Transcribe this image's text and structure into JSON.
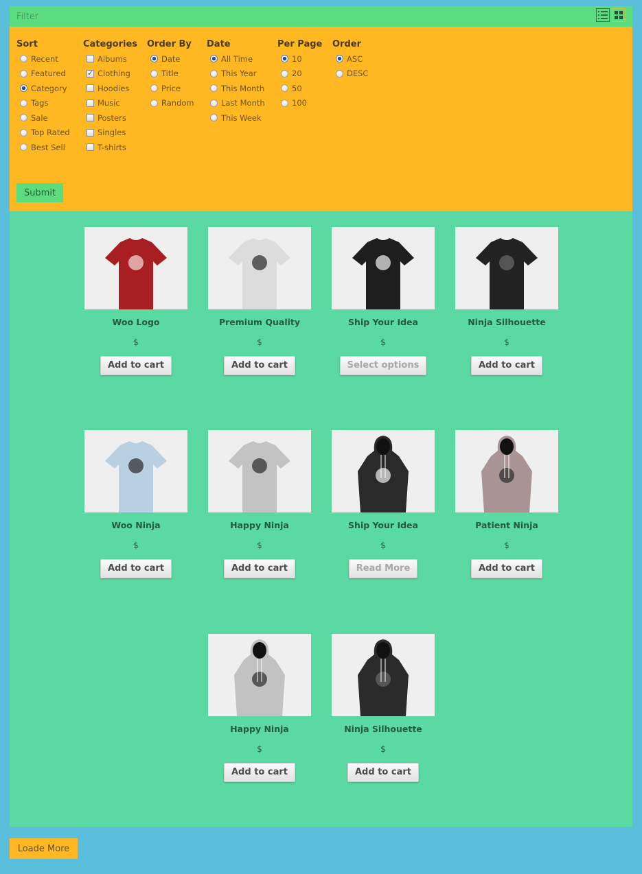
{
  "header": {
    "title": "Filter",
    "view_icons": [
      "list-view-icon",
      "grid-view-icon"
    ]
  },
  "filters": {
    "sort": {
      "heading": "Sort",
      "type": "radio",
      "options": [
        "Recent",
        "Featured",
        "Category",
        "Tags",
        "Sale",
        "Top Rated",
        "Best Sell"
      ],
      "selected": "Category"
    },
    "categories": {
      "heading": "Categories",
      "type": "checkbox",
      "options": [
        "Albums",
        "Clothing",
        "Hoodies",
        "Music",
        "Posters",
        "Singles",
        "T-shirts"
      ],
      "checked": [
        "Clothing"
      ]
    },
    "order_by": {
      "heading": "Order By",
      "type": "radio",
      "options": [
        "Date",
        "Title",
        "Price",
        "Random"
      ],
      "selected": "Date"
    },
    "date": {
      "heading": "Date",
      "type": "radio",
      "options": [
        "All Time",
        "This Year",
        "This Month",
        "Last Month",
        "This Week"
      ],
      "selected": "All Time"
    },
    "per_page": {
      "heading": "Per Page",
      "type": "radio",
      "options": [
        "10",
        "20",
        "50",
        "100"
      ],
      "selected": "10"
    },
    "order": {
      "heading": "Order",
      "type": "radio",
      "options": [
        "ASC",
        "DESC"
      ],
      "selected": "ASC"
    },
    "submit_label": "Submit"
  },
  "products": [
    {
      "name": "Woo Logo",
      "price": "$",
      "button": "Add to cart",
      "button_muted": false,
      "image": "red-tshirt-woo"
    },
    {
      "name": "Premium Quality",
      "price": "$",
      "button": "Add to cart",
      "button_muted": false,
      "image": "white-tshirt"
    },
    {
      "name": "Ship Your Idea",
      "price": "$",
      "button": "Select options",
      "button_muted": true,
      "image": "black-tshirt-skull"
    },
    {
      "name": "Ninja Silhouette",
      "price": "$",
      "button": "Add to cart",
      "button_muted": false,
      "image": "black-tshirt-ninja"
    },
    {
      "name": "Woo Ninja",
      "price": "$",
      "button": "Add to cart",
      "button_muted": false,
      "image": "blue-tshirt-ninja"
    },
    {
      "name": "Happy Ninja",
      "price": "$",
      "button": "Add to cart",
      "button_muted": false,
      "image": "grey-tshirt-ninja"
    },
    {
      "name": "Ship Your Idea",
      "price": "$",
      "button": "Read More",
      "button_muted": true,
      "image": "black-hoodie-skull"
    },
    {
      "name": "Patient Ninja",
      "price": "$",
      "button": "Add to cart",
      "button_muted": false,
      "image": "mauve-hoodie-ninja"
    },
    {
      "name": "Happy Ninja",
      "price": "$",
      "button": "Add to cart",
      "button_muted": false,
      "image": "grey-hoodie-ninja"
    },
    {
      "name": "Ninja Silhouette",
      "price": "$",
      "button": "Add to cart",
      "button_muted": false,
      "image": "black-hoodie-ninja"
    }
  ],
  "footer": {
    "load_more_label": "Loade More"
  },
  "colors": {
    "page_bg": "#5bbfdb",
    "filter_bar": "#5bdc7e",
    "filter_panel": "#ffb822",
    "products_bg": "#5ad9a3"
  }
}
